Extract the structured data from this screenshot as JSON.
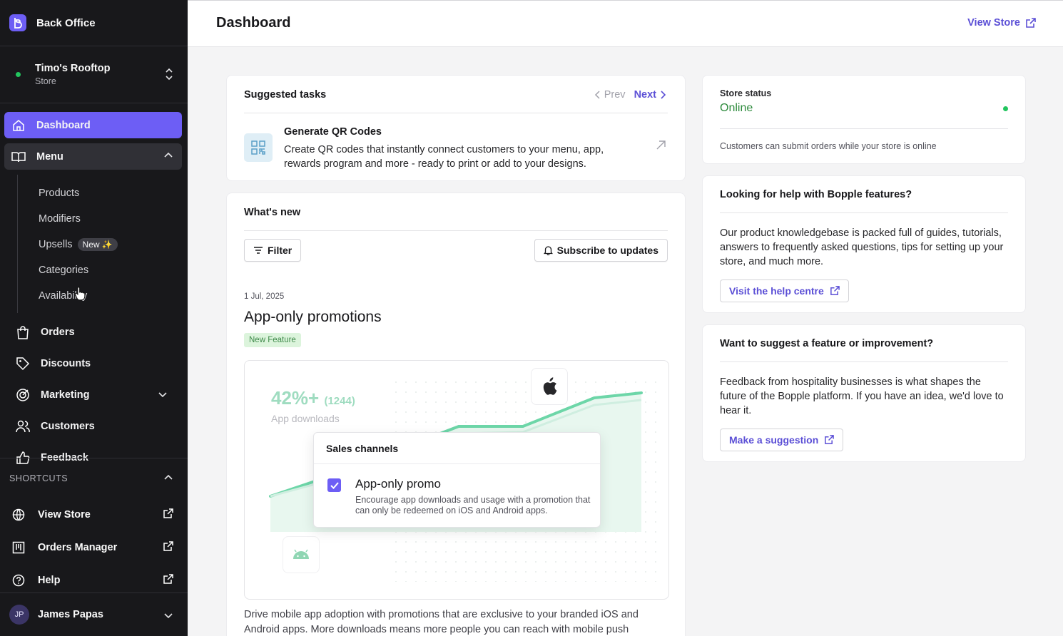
{
  "sidebar": {
    "brand": "Back Office",
    "store": {
      "name": "Timo's Rooftop",
      "type": "Store"
    },
    "nav": {
      "dashboard": "Dashboard",
      "menu": "Menu",
      "menu_items": [
        "Products",
        "Modifiers",
        "Upsells",
        "Categories",
        "Availability"
      ],
      "upsells_badge": "New ✨",
      "orders": "Orders",
      "discounts": "Discounts",
      "marketing": "Marketing",
      "customers": "Customers",
      "feedback": "Feedback"
    },
    "shortcuts": {
      "heading": "SHORTCUTS",
      "items": [
        "View Store",
        "Orders Manager",
        "Help"
      ]
    },
    "user": {
      "initials": "JP",
      "name": "James Papas"
    }
  },
  "topbar": {
    "title": "Dashboard",
    "view_store": "View Store"
  },
  "tasks": {
    "heading": "Suggested tasks",
    "prev": "Prev",
    "next": "Next",
    "item_title": "Generate QR Codes",
    "item_desc": "Create QR codes that instantly connect customers to your menu, app, rewards program and more - ready to print or add to your designs."
  },
  "news": {
    "heading": "What's new",
    "filter": "Filter",
    "subscribe": "Subscribe to updates",
    "date": "1 Jul, 2025",
    "title": "App-only promotions",
    "tag": "New Feature",
    "illustration": {
      "stat": "42%+",
      "stat_count": "(1244)",
      "stat_label": "App downloads",
      "overlay_heading": "Sales channels",
      "overlay_title": "App-only promo",
      "overlay_desc": "Encourage app downloads and usage with a promotion that can only be redeemed on iOS and Android apps."
    },
    "body": "Drive mobile app adoption with promotions that are exclusive to your branded iOS and Android apps. More downloads means more people you can reach with mobile push"
  },
  "status": {
    "label": "Store status",
    "value": "Online",
    "note": "Customers can submit orders while your store is online"
  },
  "help": {
    "heading": "Looking for help with Bopple features?",
    "text": "Our product knowledgebase is packed full of guides, tutorials, answers to frequently asked questions, tips for setting up your store, and much more.",
    "link": "Visit the help centre"
  },
  "suggest": {
    "heading": "Want to suggest a feature or improvement?",
    "text": "Feedback from hospitality businesses is what shapes the future of the Bopple platform. If you have an idea, we'd love to hear it.",
    "link": "Make a suggestion"
  },
  "colors": {
    "accent": "#6d5ef5",
    "link": "#5b4fd6",
    "sidebar_bg": "#18181b",
    "online": "#22c55e",
    "chart_green": "#5fd3a3"
  }
}
